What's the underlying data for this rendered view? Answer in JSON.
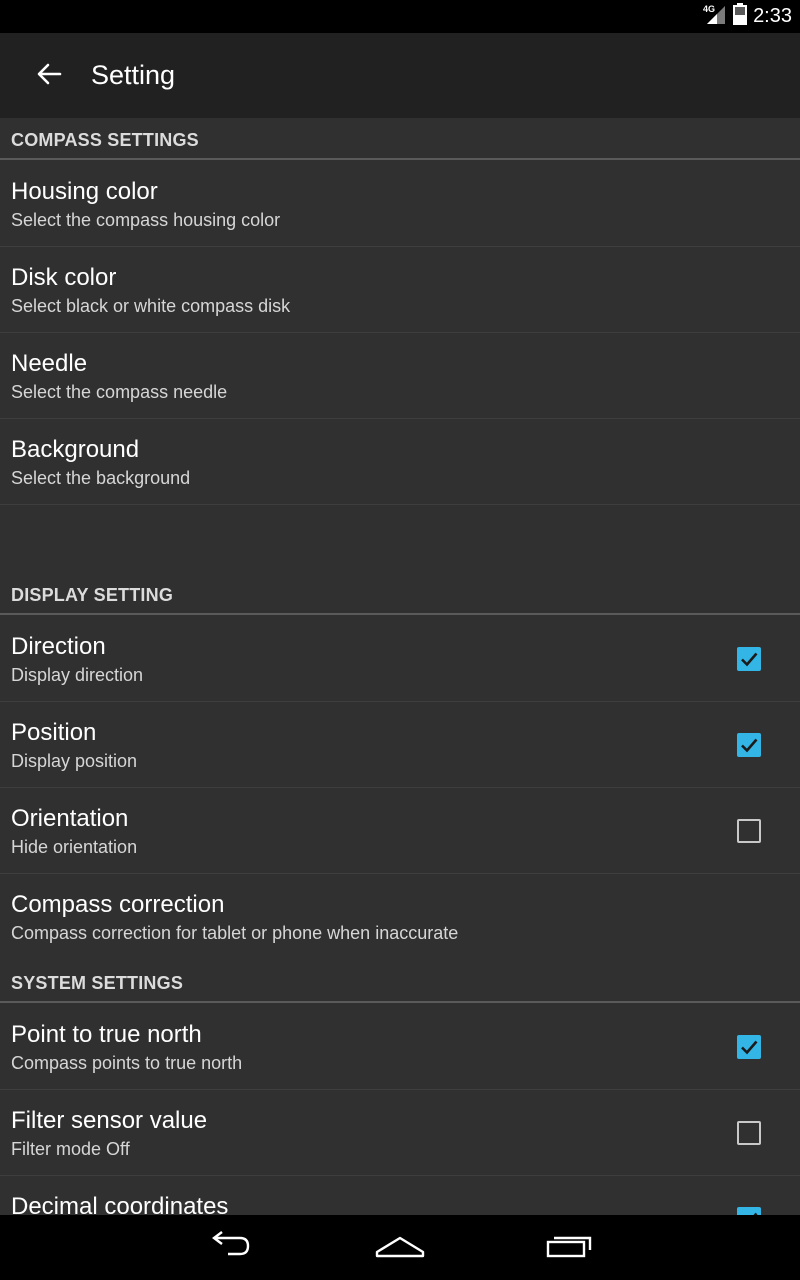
{
  "status_bar": {
    "network": "4G",
    "time": "2:33"
  },
  "app_bar": {
    "title": "Setting"
  },
  "sections": {
    "compass": {
      "header": "COMPASS SETTINGS",
      "items": [
        {
          "title": "Housing color",
          "summary": "Select the compass housing color"
        },
        {
          "title": "Disk color",
          "summary": "Select black or white compass disk"
        },
        {
          "title": "Needle",
          "summary": "Select the compass needle"
        },
        {
          "title": "Background",
          "summary": "Select the background"
        }
      ]
    },
    "display": {
      "header": "DISPLAY SETTING",
      "items": [
        {
          "title": "Direction",
          "summary": "Display direction",
          "checked": true
        },
        {
          "title": "Position",
          "summary": "Display position",
          "checked": true
        },
        {
          "title": "Orientation",
          "summary": "Hide orientation",
          "checked": false
        },
        {
          "title": "Compass correction",
          "summary": "Compass correction for tablet or phone when inaccurate"
        }
      ]
    },
    "system": {
      "header": "SYSTEM SETTINGS",
      "items": [
        {
          "title": "Point to true north",
          "summary": "Compass points to true north",
          "checked": true
        },
        {
          "title": "Filter sensor value",
          "summary": "Filter mode Off",
          "checked": false
        },
        {
          "title": "Decimal coordinates",
          "checked": true
        }
      ]
    }
  },
  "colors": {
    "accent": "#33b5e5",
    "background": "#303030",
    "app_bar": "#212121"
  },
  "icons": {
    "app_bar": "back-arrow-icon",
    "nav": [
      "back-nav-icon",
      "home-nav-icon",
      "recents-nav-icon"
    ]
  }
}
